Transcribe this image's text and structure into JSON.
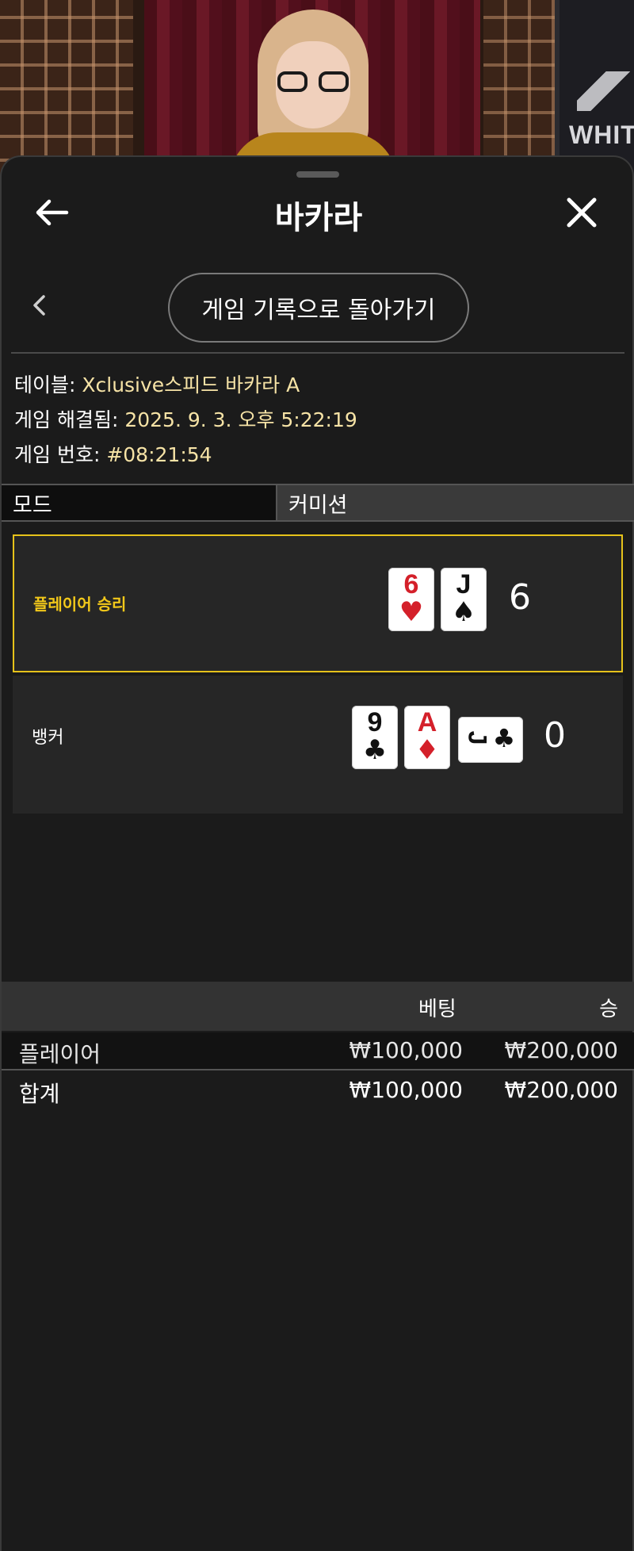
{
  "video": {
    "sign_text": "WHITE"
  },
  "header": {
    "title": "바카라"
  },
  "back_history_label": "게임 기록으로 돌아가기",
  "info": {
    "table_label": "테이블: ",
    "table_value": "Xclusive스피드 바카라 A",
    "resolved_label": "게임 해결됨: ",
    "resolved_value": "2025. 9. 3. 오후 5:22:19",
    "game_no_label": "게임 번호: ",
    "game_no_value": "#08:21:54"
  },
  "tabs": {
    "mode": "모드",
    "commission": "커미션"
  },
  "results": {
    "player": {
      "label": "플레이어 승리",
      "score": "6",
      "cards": [
        {
          "rank": "6",
          "suit": "♥",
          "color": "red"
        },
        {
          "rank": "J",
          "suit": "♠",
          "color": "black"
        }
      ]
    },
    "banker": {
      "label": "뱅커",
      "score": "0",
      "cards": [
        {
          "rank": "9",
          "suit": "♣",
          "color": "black"
        },
        {
          "rank": "A",
          "suit": "♦",
          "color": "red"
        },
        {
          "rank": "J",
          "suit": "♣",
          "color": "black",
          "rotated": true
        }
      ]
    }
  },
  "bets": {
    "headers": {
      "bet": "베팅",
      "win": "승"
    },
    "rows": [
      {
        "label": "플레이어",
        "bet": "₩100,000",
        "win": "₩200,000"
      }
    ],
    "total": {
      "label": "합계",
      "bet": "₩100,000",
      "win": "₩200,000"
    }
  },
  "colors": {
    "accent": "#e6c21a",
    "info_value": "#f6e3a6",
    "panel_bg": "#1b1b1b"
  }
}
